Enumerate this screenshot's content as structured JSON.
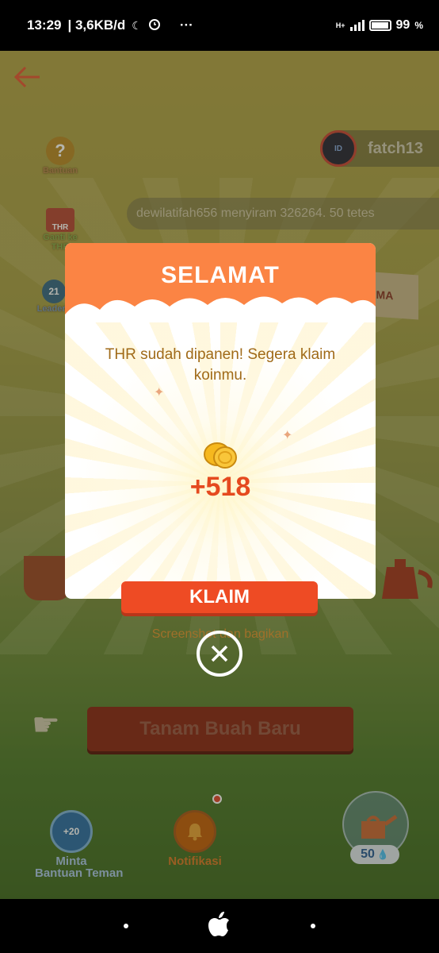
{
  "status_bar": {
    "time": "13:29",
    "net_speed": "| 3,6KB/d",
    "moon": "☾",
    "more": "···",
    "network_type": "H+",
    "battery": "99",
    "battery_unit": "%"
  },
  "side_menu": {
    "help": "Bantuan",
    "thr_badge": "THR",
    "thr_label": "Ganti ke THR",
    "leaderboard_label": "Leaderb"
  },
  "user": {
    "name": "fatch13"
  },
  "ticker": {
    "text": "dewilatifah656 menyiram 326264. 50 tetes"
  },
  "banner": {
    "text": "SALING SIRAM, PANEN BERSAMA"
  },
  "main_button": {
    "label": "Tanam Buah Baru"
  },
  "bottom_nav": {
    "ask_badge": "+20",
    "ask_label_1": "Minta",
    "ask_label_2": "Bantuan Teman",
    "notif_label": "Notifikasi",
    "water_count": "50"
  },
  "modal": {
    "title": "SELAMAT",
    "message": "THR sudah dipanen! Segera klaim koinmu.",
    "reward": "+518",
    "claim_label": "KLAIM",
    "share_label": "Screenshot dan bagikan"
  },
  "close": {
    "icon": "close-icon"
  }
}
